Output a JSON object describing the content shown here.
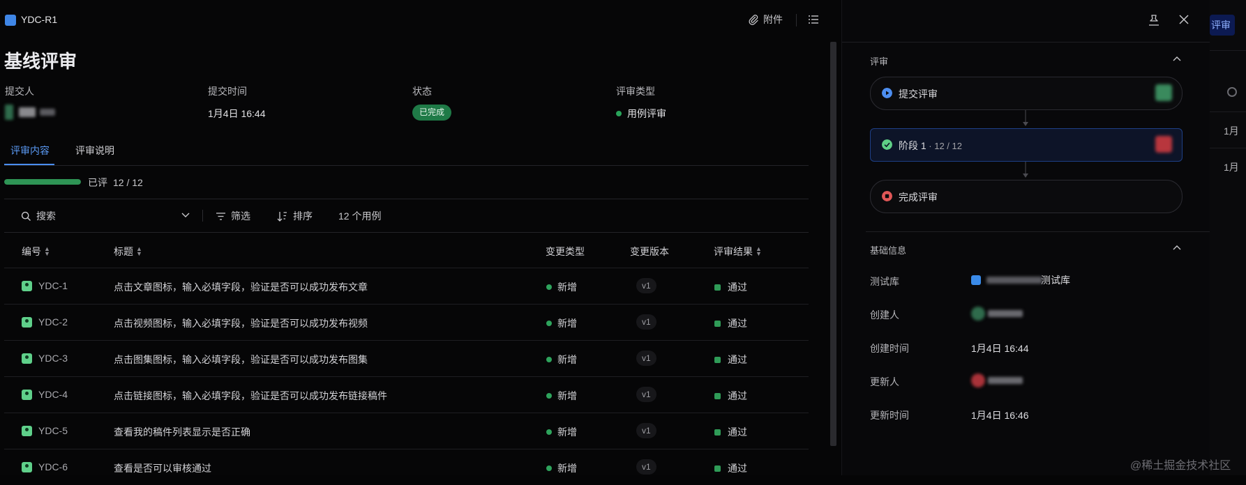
{
  "header": {
    "title": "YDC-R1",
    "attachment_label": "附件"
  },
  "page": {
    "title": "基线评审"
  },
  "meta": {
    "submitter_label": "提交人",
    "submit_time_label": "提交时间",
    "submit_time": "1月4日 16:44",
    "status_label": "状态",
    "status": "已完成",
    "review_type_label": "评审类型",
    "review_type": "用例评审"
  },
  "tabs": [
    {
      "label": "评审内容"
    },
    {
      "label": "评审说明"
    }
  ],
  "progress": {
    "label": "已评",
    "text": "12 / 12",
    "fraction": 1.0
  },
  "toolbar": {
    "search_label": "搜索",
    "filter_label": "筛选",
    "sort_label": "排序",
    "count_label": "12 个用例"
  },
  "table": {
    "headers": {
      "id": "编号",
      "title": "标题",
      "change_type": "变更类型",
      "version": "变更版本",
      "result": "评审结果"
    },
    "rows": [
      {
        "id": "YDC-1",
        "title": "点击文章图标，输入必填字段，验证是否可以成功发布文章",
        "change_type": "新增",
        "version": "v1",
        "result": "通过"
      },
      {
        "id": "YDC-2",
        "title": "点击视频图标，输入必填字段，验证是否可以成功发布视频",
        "change_type": "新增",
        "version": "v1",
        "result": "通过"
      },
      {
        "id": "YDC-3",
        "title": "点击图集图标，输入必填字段，验证是否可以成功发布图集",
        "change_type": "新增",
        "version": "v1",
        "result": "通过"
      },
      {
        "id": "YDC-4",
        "title": "点击链接图标，输入必填字段，验证是否可以成功发布链接稿件",
        "change_type": "新增",
        "version": "v1",
        "result": "通过"
      },
      {
        "id": "YDC-5",
        "title": "查看我的稿件列表显示是否正确",
        "change_type": "新增",
        "version": "v1",
        "result": "通过"
      },
      {
        "id": "YDC-6",
        "title": "查看是否可以审核通过",
        "change_type": "新增",
        "version": "v1",
        "result": "通过"
      }
    ]
  },
  "drawer": {
    "review_section": "评审",
    "flow": [
      {
        "label": "提交评审",
        "sub": ""
      },
      {
        "label": "阶段 1",
        "sub": " · 12 / 12"
      },
      {
        "label": "完成评审",
        "sub": ""
      }
    ],
    "basic_section": "基础信息",
    "info": {
      "repo_label": "测试库",
      "repo_value": "测试库",
      "creator_label": "创建人",
      "created_time_label": "创建时间",
      "created_time": "1月4日 16:44",
      "updater_label": "更新人",
      "updated_time_label": "更新时间",
      "updated_time": "1月4日 16:46"
    }
  },
  "peek": {
    "button_label": "评审",
    "row1": "1月",
    "row2": "1月"
  },
  "watermark": "@稀土掘金技术社区",
  "colors": {
    "accent": "#4a8df0",
    "success": "#2e9455",
    "danger": "#e15757"
  }
}
